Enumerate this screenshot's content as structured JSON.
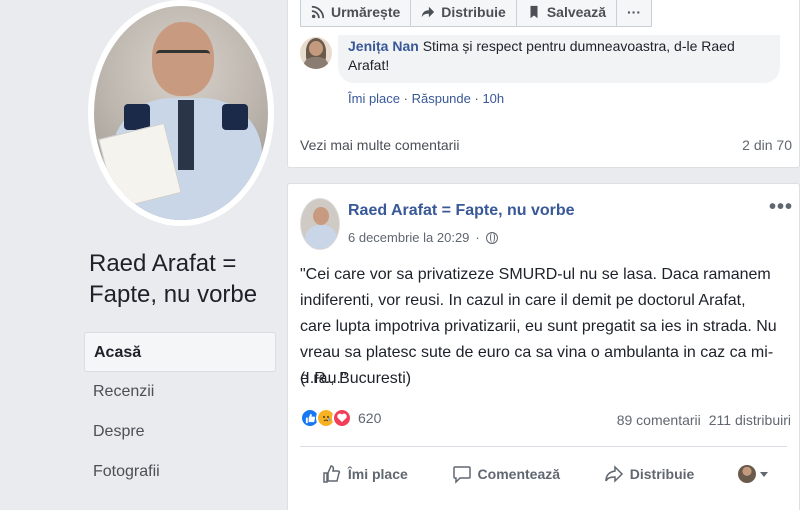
{
  "sidebar": {
    "page_name": "Raed Arafat = Fapte, nu vorbe",
    "nav": [
      {
        "label": "Acasă",
        "active": true
      },
      {
        "label": "Recenzii"
      },
      {
        "label": "Despre"
      },
      {
        "label": "Fotografii"
      }
    ]
  },
  "top_actions": {
    "follow": "Urmărește",
    "share": "Distribuie",
    "save": "Salvează",
    "more": "···"
  },
  "comment": {
    "author": "Jenița Nan",
    "text": "Stima și respect pentru dumneavoastra, d-le Raed Arafat!",
    "like": "Îmi place",
    "reply": "Răspunde",
    "sep": " · ",
    "time": "10h"
  },
  "more_comments": {
    "label": "Vezi mai multe comentarii",
    "count": "2 din 70"
  },
  "post": {
    "author": "Raed Arafat = Fapte, nu vorbe",
    "date": "6 decembrie la 20:29",
    "sep": " · ",
    "menu": "•••",
    "text": "\"Cei care vor sa privatizeze SMURD-ul nu se lasa. Daca ramanem indiferenti, vor reusi. In cazul in care il demit pe doctorul Arafat, care lupta impotriva privatizarii, eu sunt pregatit sa ies in strada. Nu vreau sa platesc sute de euro ca sa vina o ambulanta in caz ca mi-e rau.\"",
    "signature": "(I.R., Bucuresti)",
    "reaction_count": "620",
    "comments": "89 comentarii",
    "shares": "211 distribuiri",
    "actions": {
      "like": "Îmi place",
      "comment": "Comentează",
      "share": "Distribuie"
    }
  },
  "colors": {
    "link_blue": "#385898",
    "like_blue": "#1877f2",
    "love_red": "#f33e58",
    "sad_yellow": "#f7b125"
  }
}
